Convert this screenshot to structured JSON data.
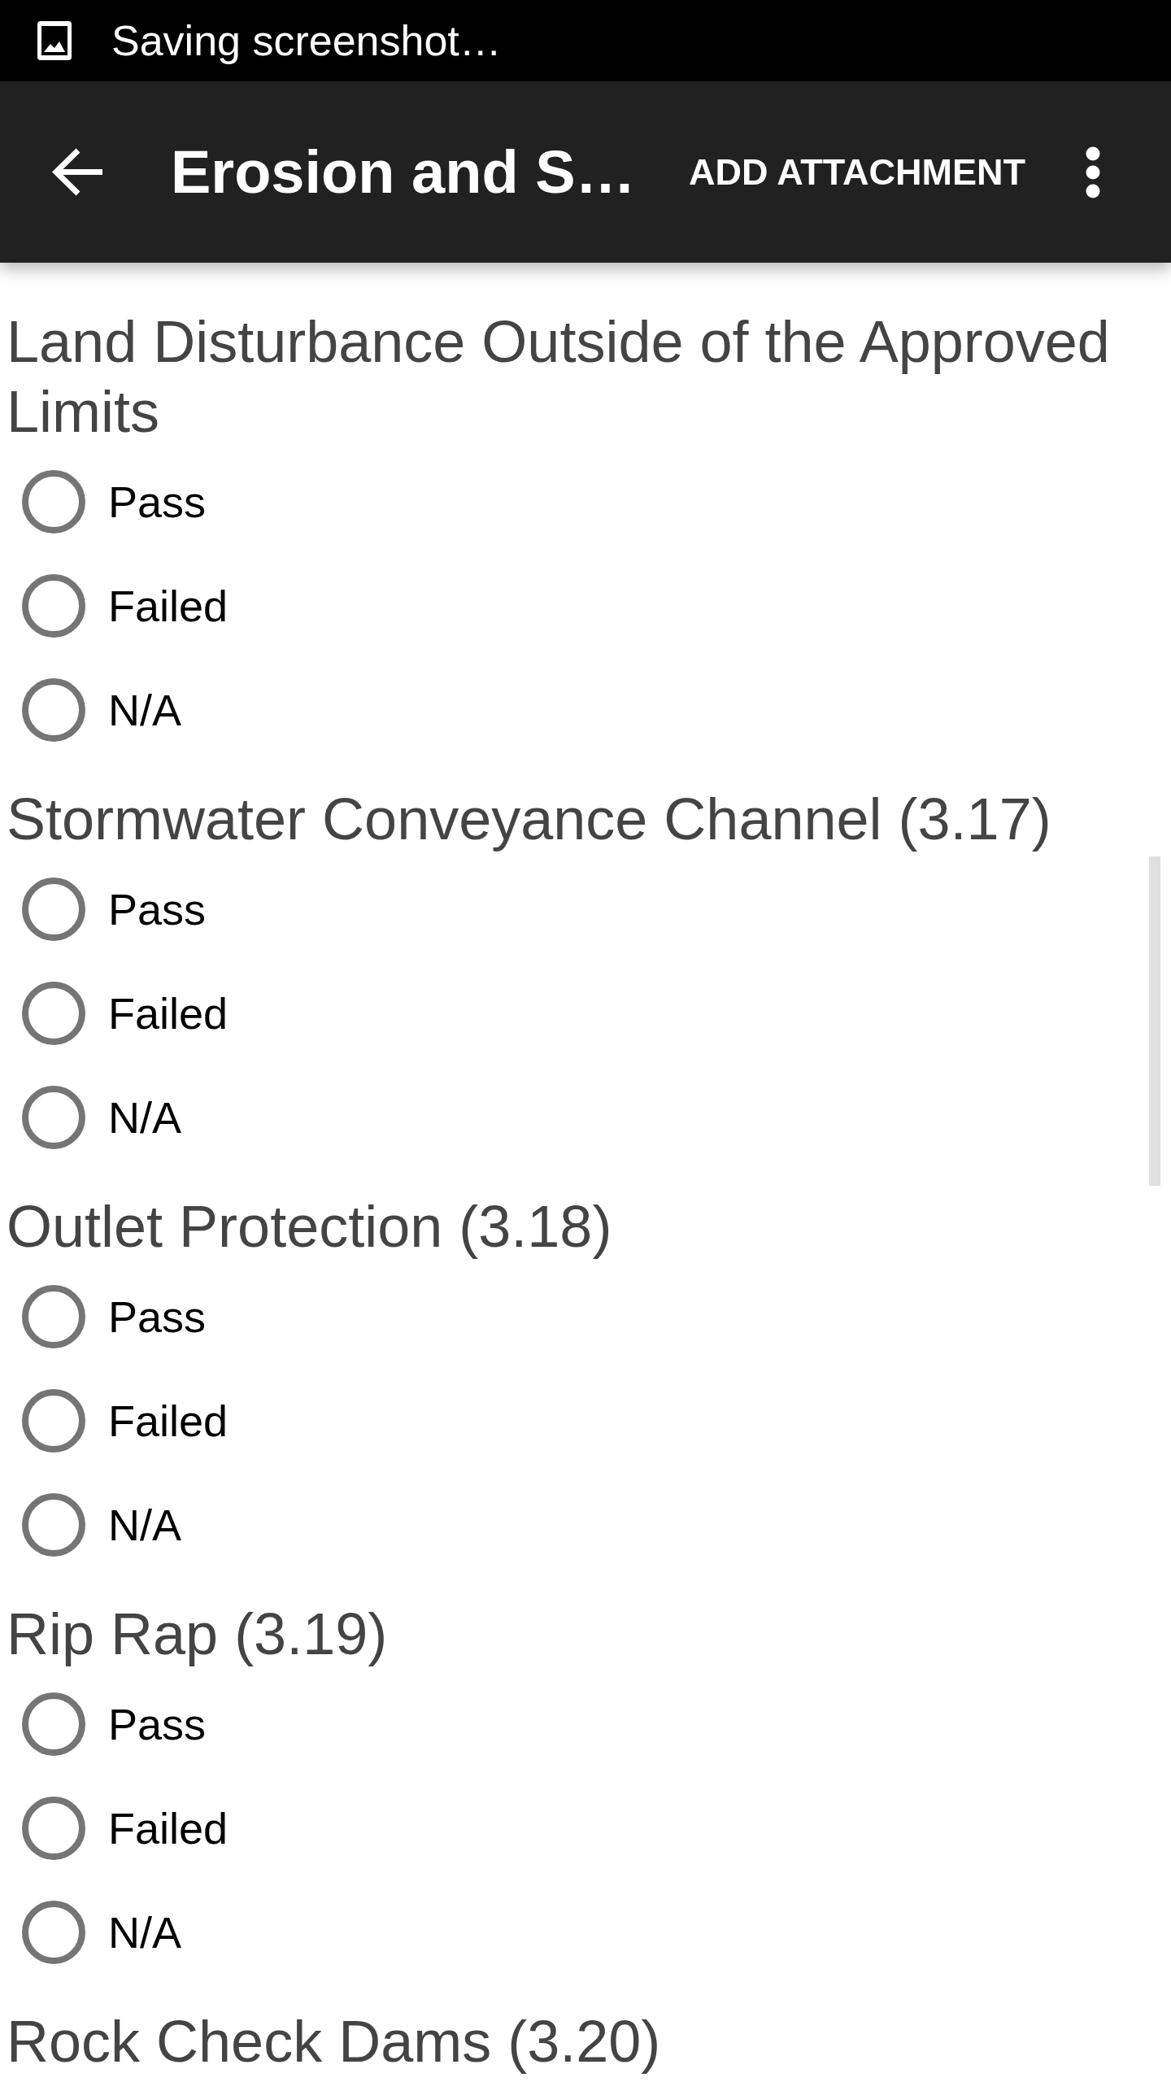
{
  "status_bar": {
    "notification": "Saving screenshot…"
  },
  "toolbar": {
    "title": "Erosion and S…",
    "action": "ADD ATTACHMENT"
  },
  "questions": [
    {
      "label": "Land Disturbance Outside of the Approved Limits",
      "options": [
        {
          "label": "Pass",
          "selected": false
        },
        {
          "label": "Failed",
          "selected": false
        },
        {
          "label": "N/A",
          "selected": false
        }
      ]
    },
    {
      "label": "Stormwater Conveyance Channel (3.17)",
      "options": [
        {
          "label": "Pass",
          "selected": false
        },
        {
          "label": "Failed",
          "selected": false
        },
        {
          "label": "N/A",
          "selected": false
        }
      ]
    },
    {
      "label": "Outlet Protection (3.18)",
      "options": [
        {
          "label": "Pass",
          "selected": false
        },
        {
          "label": "Failed",
          "selected": false
        },
        {
          "label": "N/A",
          "selected": false
        }
      ]
    },
    {
      "label": "Rip Rap (3.19)",
      "options": [
        {
          "label": "Pass",
          "selected": false
        },
        {
          "label": "Failed",
          "selected": false
        },
        {
          "label": "N/A",
          "selected": false
        }
      ]
    },
    {
      "label": "Rock Check Dams (3.20)"
    }
  ]
}
